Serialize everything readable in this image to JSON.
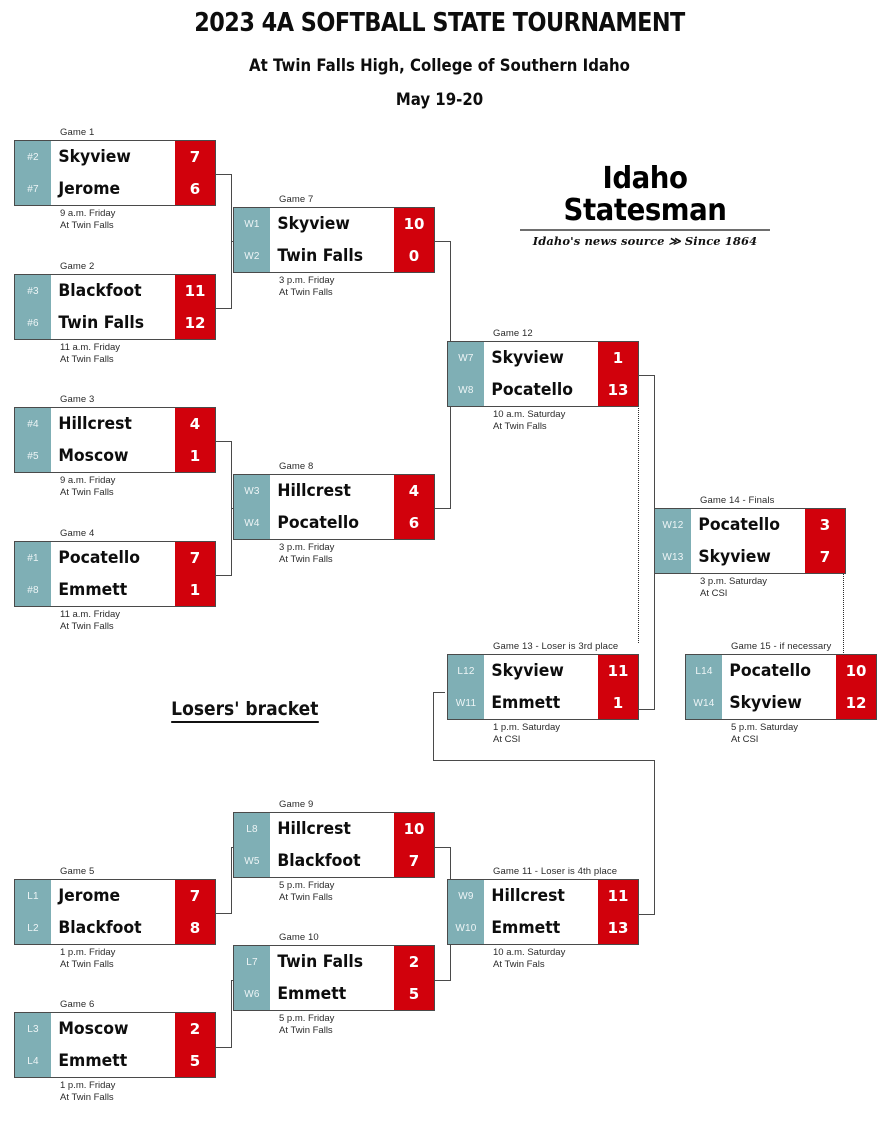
{
  "header": {
    "title": "2023 4A SOFTBALL STATE TOURNAMENT",
    "subtitle": "At Twin Falls High, College of Southern Idaho",
    "dateline": "May 19-20"
  },
  "masthead": {
    "name": "Idaho Statesman",
    "tagline": "Idaho's news source ≫ Since 1864"
  },
  "losers_bracket_label": "Losers' bracket",
  "colors": {
    "seed_block": "#7fafb5",
    "score_block": "#d1010c",
    "border": "#4a4a4a",
    "text": "#0d0d0d"
  },
  "games": [
    {
      "id": "game1",
      "label": "Game 1",
      "teams": [
        {
          "seed": "#2",
          "name": "Skyview",
          "score": "7"
        },
        {
          "seed": "#7",
          "name": "Jerome",
          "score": "6"
        }
      ],
      "time": "9 a.m. Friday",
      "venue": "At Twin Falls"
    },
    {
      "id": "game2",
      "label": "Game 2",
      "teams": [
        {
          "seed": "#3",
          "name": "Blackfoot",
          "score": "11"
        },
        {
          "seed": "#6",
          "name": "Twin Falls",
          "score": "12"
        }
      ],
      "time": "11 a.m. Friday",
      "venue": "At Twin Falls"
    },
    {
      "id": "game3",
      "label": "Game 3",
      "teams": [
        {
          "seed": "#4",
          "name": "Hillcrest",
          "score": "4"
        },
        {
          "seed": "#5",
          "name": "Moscow",
          "score": "1"
        }
      ],
      "time": "9 a.m. Friday",
      "venue": "At Twin Falls"
    },
    {
      "id": "game4",
      "label": "Game 4",
      "teams": [
        {
          "seed": "#1",
          "name": "Pocatello",
          "score": "7"
        },
        {
          "seed": "#8",
          "name": "Emmett",
          "score": "1"
        }
      ],
      "time": "11 a.m. Friday",
      "venue": "At Twin Falls"
    },
    {
      "id": "game5",
      "label": "Game 5",
      "teams": [
        {
          "seed": "L1",
          "name": "Jerome",
          "score": "7"
        },
        {
          "seed": "L2",
          "name": "Blackfoot",
          "score": "8"
        }
      ],
      "time": "1 p.m. Friday",
      "venue": "At Twin Falls"
    },
    {
      "id": "game6",
      "label": "Game 6",
      "teams": [
        {
          "seed": "L3",
          "name": "Moscow",
          "score": "2"
        },
        {
          "seed": "L4",
          "name": "Emmett",
          "score": "5"
        }
      ],
      "time": "1 p.m. Friday",
      "venue": "At Twin Falls"
    },
    {
      "id": "game7",
      "label": "Game 7",
      "teams": [
        {
          "seed": "W1",
          "name": "Skyview",
          "score": "10"
        },
        {
          "seed": "W2",
          "name": "Twin Falls",
          "score": "0"
        }
      ],
      "time": "3 p.m. Friday",
      "venue": "At Twin Falls"
    },
    {
      "id": "game8",
      "label": "Game 8",
      "teams": [
        {
          "seed": "W3",
          "name": "Hillcrest",
          "score": "4"
        },
        {
          "seed": "W4",
          "name": "Pocatello",
          "score": "6"
        }
      ],
      "time": "3 p.m. Friday",
      "venue": "At Twin Falls"
    },
    {
      "id": "game9",
      "label": "Game 9",
      "teams": [
        {
          "seed": "L8",
          "name": "Hillcrest",
          "score": "10"
        },
        {
          "seed": "W5",
          "name": "Blackfoot",
          "score": "7"
        }
      ],
      "time": "5 p.m. Friday",
      "venue": "At Twin Falls"
    },
    {
      "id": "game10",
      "label": "Game 10",
      "teams": [
        {
          "seed": "L7",
          "name": "Twin Falls",
          "score": "2"
        },
        {
          "seed": "W6",
          "name": "Emmett",
          "score": "5"
        }
      ],
      "time": "5 p.m. Friday",
      "venue": "At Twin Falls"
    },
    {
      "id": "game11",
      "label": "Game 11 - Loser is 4th place",
      "teams": [
        {
          "seed": "W9",
          "name": "Hillcrest",
          "score": "11"
        },
        {
          "seed": "W10",
          "name": "Emmett",
          "score": "13"
        }
      ],
      "time": "10 a.m. Saturday",
      "venue": "At Twin Fals"
    },
    {
      "id": "game12",
      "label": "Game 12",
      "teams": [
        {
          "seed": "W7",
          "name": "Skyview",
          "score": "1"
        },
        {
          "seed": "W8",
          "name": "Pocatello",
          "score": "13"
        }
      ],
      "time": "10 a.m. Saturday",
      "venue": "At Twin Falls"
    },
    {
      "id": "game13",
      "label": "Game 13 - Loser is 3rd place",
      "teams": [
        {
          "seed": "L12",
          "name": "Skyview",
          "score": "11"
        },
        {
          "seed": "W11",
          "name": "Emmett",
          "score": "1"
        }
      ],
      "time": "1 p.m. Saturday",
      "venue": "At CSI"
    },
    {
      "id": "game14",
      "label": "Game 14 - Finals",
      "teams": [
        {
          "seed": "W12",
          "name": "Pocatello",
          "score": "3"
        },
        {
          "seed": "W13",
          "name": "Skyview",
          "score": "7"
        }
      ],
      "time": "3 p.m. Saturday",
      "venue": "At CSI"
    },
    {
      "id": "game15",
      "label": "Game 15 - if necessary",
      "teams": [
        {
          "seed": "L14",
          "name": "Pocatello",
          "score": "10"
        },
        {
          "seed": "W14",
          "name": "Skyview",
          "score": "12"
        }
      ],
      "time": "5 p.m. Saturday",
      "venue": "At CSI"
    }
  ]
}
